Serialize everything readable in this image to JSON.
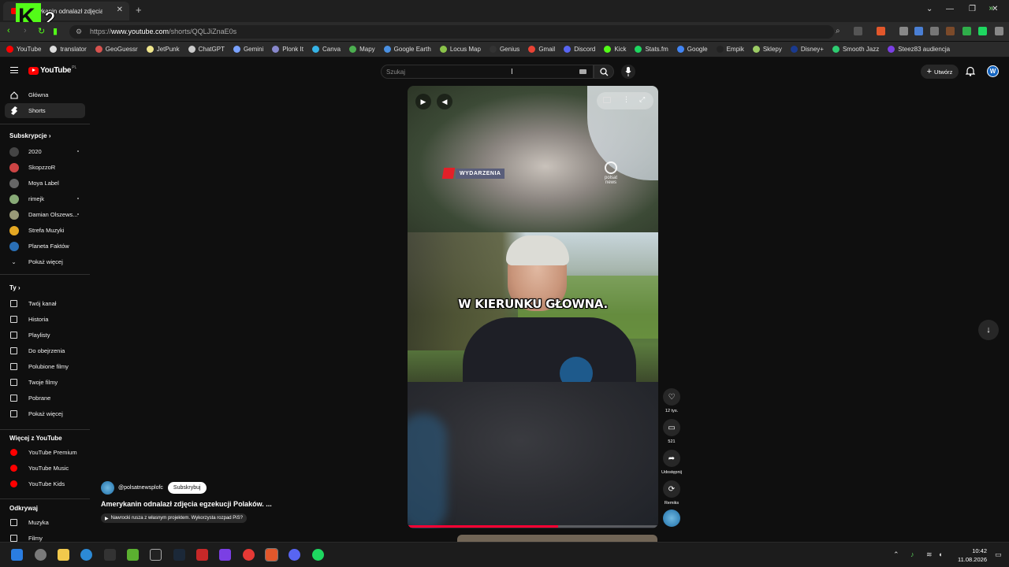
{
  "browser": {
    "tab_title": "Amerykanin odnalazł zdjęcia eg",
    "url_prefix": "https://",
    "url_host": "www.youtube.com",
    "url_path": "/shorts/QQLJiZnaE0s",
    "overlay_logo": "K2",
    "bookmarks": [
      {
        "label": "YouTube",
        "color": "#ff0000"
      },
      {
        "label": "translator",
        "color": "#dddddd"
      },
      {
        "label": "GeoGuessr",
        "color": "#d9534f"
      },
      {
        "label": "JetPunk",
        "color": "#f0e68c"
      },
      {
        "label": "ChatGPT",
        "color": "#cccccc"
      },
      {
        "label": "Gemini",
        "color": "#7aa2ff"
      },
      {
        "label": "Plonk It",
        "color": "#88c"
      },
      {
        "label": "Canva",
        "color": "#36b3e6"
      },
      {
        "label": "Mapy",
        "color": "#4caf50"
      },
      {
        "label": "Google Earth",
        "color": "#4a90e2"
      },
      {
        "label": "Locus Map",
        "color": "#8bc34a"
      },
      {
        "label": "Genius",
        "color": "#333333"
      },
      {
        "label": "Gmail",
        "color": "#ea4335"
      },
      {
        "label": "Discord",
        "color": "#5865f2"
      },
      {
        "label": "Kick",
        "color": "#53fc18"
      },
      {
        "label": "Stats.fm",
        "color": "#1ed760"
      },
      {
        "label": "Google",
        "color": "#4285f4"
      },
      {
        "label": "Empik",
        "color": "#222222"
      },
      {
        "label": "Sklepy",
        "color": "#9ccc65"
      },
      {
        "label": "Disney+",
        "color": "#1a3a8f"
      },
      {
        "label": "Smooth Jazz",
        "color": "#2ecc71"
      },
      {
        "label": "Steez83 audiencja",
        "color": "#7b3fe4"
      }
    ]
  },
  "youtube": {
    "logo_text": "YouTube",
    "logo_region": "PL",
    "search_placeholder": "Szukaj",
    "create_label": "Utwórz",
    "avatar_letter": "W"
  },
  "sidebar": {
    "main": [
      {
        "label": "Główna"
      },
      {
        "label": "Shorts"
      }
    ],
    "subs_header": "Subskrypcje",
    "subs": [
      {
        "label": "2020",
        "color": "#444"
      },
      {
        "label": "SkopzzoR",
        "color": "#c44"
      },
      {
        "label": "Moya Label",
        "color": "#666"
      },
      {
        "label": "rimejk",
        "color": "#8a7"
      },
      {
        "label": "Damian Olszews...",
        "color": "#997"
      },
      {
        "label": "Strefa Muzyki",
        "color": "#e5a823"
      },
      {
        "label": "Planeta Faktów",
        "color": "#2a6fb5"
      },
      {
        "label": "Pokaż więcej",
        "color": ""
      }
    ],
    "you_header": "Ty",
    "you": [
      {
        "label": "Twój kanał"
      },
      {
        "label": "Historia"
      },
      {
        "label": "Playlisty"
      },
      {
        "label": "Do obejrzenia"
      },
      {
        "label": "Polubione filmy"
      },
      {
        "label": "Twoje filmy"
      },
      {
        "label": "Pobrane"
      },
      {
        "label": "Pokaż więcej"
      }
    ],
    "more_header": "Więcej z YouTube",
    "more": [
      {
        "label": "YouTube Premium"
      },
      {
        "label": "YouTube Music"
      },
      {
        "label": "YouTube Kids"
      }
    ],
    "explore_header": "Odkrywaj",
    "explore": [
      {
        "label": "Muzyka"
      },
      {
        "label": "Filmy"
      }
    ]
  },
  "short": {
    "badge": "WYDARZENIA",
    "news_logo_line1": "polsat",
    "news_logo_line2": "news",
    "subtitle": "W KIERUNKU GŁOWNA.",
    "progress": 0.6,
    "channel": "@polsatnewsplofc",
    "subscribe_label": "Subskrybuj",
    "title": "Amerykanin odnalazł zdjęcia egzekucji Polaków. ...",
    "related": "Nawrocki rusza z własnym projektem. Wykorzysta rozpad PiS?",
    "likes": "12 tys.",
    "comments": "521",
    "share_label": "Udostępnij",
    "remix_label": "Remiks"
  },
  "taskbar": {
    "time": "10:42",
    "date": "11.08.2026"
  }
}
